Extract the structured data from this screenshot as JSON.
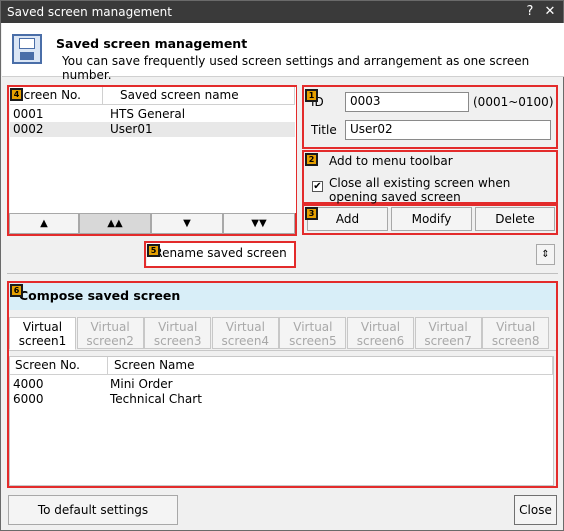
{
  "window": {
    "title": "Saved screen management",
    "help_glyph": "?",
    "close_glyph": "✕"
  },
  "header": {
    "title": "Saved screen management",
    "description": "You can save frequently used screen settings and arrangement as one screen number."
  },
  "badges": [
    "1",
    "2",
    "3",
    "4",
    "5",
    "6"
  ],
  "saved_list": {
    "columns": [
      "Screen No.",
      "Saved screen name"
    ],
    "rows": [
      {
        "no": "0001",
        "name": "HTS General"
      },
      {
        "no": "0002",
        "name": "User01"
      }
    ],
    "nav_buttons": [
      "▲",
      "▲▲",
      "▼",
      "▼▼"
    ]
  },
  "details": {
    "id_label": "ID",
    "id_value": "0003",
    "id_range": "(0001~0100)",
    "title_label": "Title",
    "title_value": "User02"
  },
  "options": {
    "add_to_menu_toolbar": "Add to menu toolbar",
    "add_to_menu_toolbar_checked": false,
    "close_existing": "Close all existing screen when opening saved screen",
    "close_existing_checked": true,
    "check_glyph": "✔"
  },
  "actions": {
    "add": "Add",
    "modify": "Modify",
    "delete": "Delete"
  },
  "rename_button": "Rename saved screen",
  "expand_glyph": "⇕",
  "compose": {
    "title": "Compose saved screen",
    "tabs": [
      {
        "line1": "Virtual",
        "line2": "screen1",
        "active": true
      },
      {
        "line1": "Virtual",
        "line2": "screen2",
        "active": false
      },
      {
        "line1": "Virtual",
        "line2": "screen3",
        "active": false
      },
      {
        "line1": "Virtual",
        "line2": "screen4",
        "active": false
      },
      {
        "line1": "Virtual",
        "line2": "screen5",
        "active": false
      },
      {
        "line1": "Virtual",
        "line2": "screen6",
        "active": false
      },
      {
        "line1": "Virtual",
        "line2": "screen7",
        "active": false
      },
      {
        "line1": "Virtual",
        "line2": "screen8",
        "active": false
      }
    ],
    "columns": [
      "Screen No.",
      "Screen Name"
    ],
    "rows": [
      {
        "no": "4000",
        "name": "Mini Order"
      },
      {
        "no": "6000",
        "name": "Technical Chart"
      }
    ]
  },
  "footer": {
    "default_button": "To default settings",
    "close_button": "Close"
  },
  "colors": {
    "highlight_red": "#e32b2b",
    "compose_header_bg": "#d8eef8",
    "titlebar_bg": "#3a3a3a"
  }
}
